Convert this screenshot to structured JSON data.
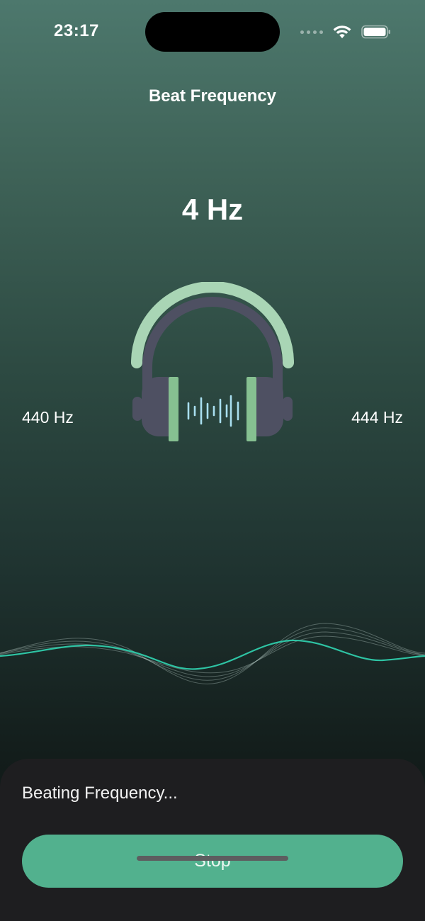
{
  "status_bar": {
    "time": "23:17"
  },
  "header": {
    "title": "Beat Frequency"
  },
  "beat": {
    "value": "4 Hz"
  },
  "channels": {
    "left": "440 Hz",
    "right": "444 Hz"
  },
  "icons": {
    "headphones": "headphones-icon",
    "wifi": "wifi-icon",
    "battery": "battery-icon",
    "signal": "signal-icon"
  },
  "colors": {
    "accent": "#52b18e",
    "wave": "#2ec4a4",
    "headband": "#a9d5b5",
    "sound_bars": "#a9dff0"
  },
  "panel": {
    "status_text": "Beating Frequency...",
    "stop_label": "Stop"
  }
}
